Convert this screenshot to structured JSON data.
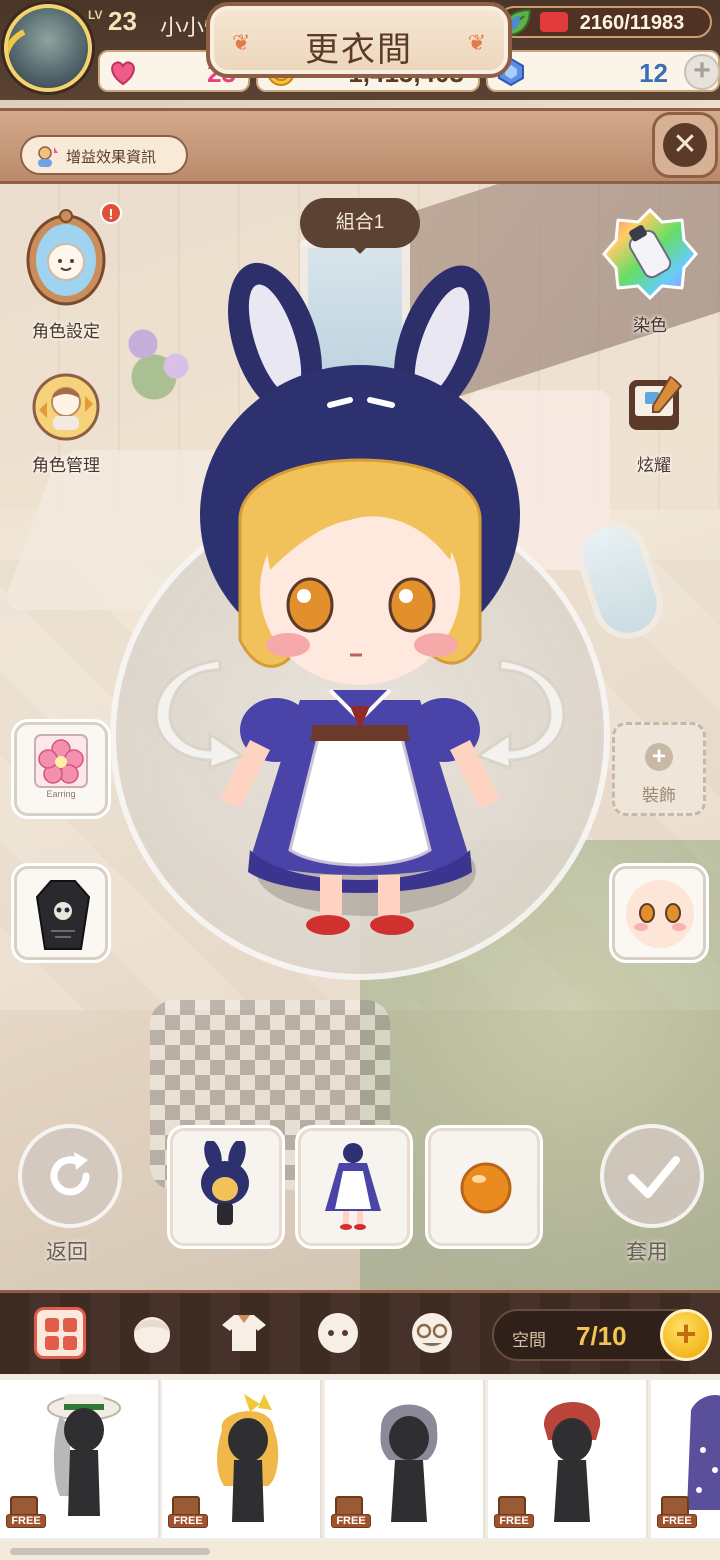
{
  "player": {
    "level_tag": "LV",
    "level": "23",
    "name": "小小慌"
  },
  "stamina": {
    "text": "2160/11983"
  },
  "resources": {
    "hearts": "23",
    "coins": "1,415,403",
    "gems": "12",
    "add_symbol": "+"
  },
  "header": {
    "buff_info_label": "增益效果資訊",
    "title": "更衣間",
    "close_symbol": "✕"
  },
  "side_left": {
    "character_settings": "角色設定",
    "character_manage": "角色管理",
    "badge": "!"
  },
  "side_right": {
    "dye": "染色",
    "show_off": "炫耀"
  },
  "combo": {
    "label": "組合1"
  },
  "slots": {
    "earring_label": "Earring",
    "decorate_label": "裝飾",
    "plus": "+"
  },
  "actions": {
    "back": "返回",
    "apply": "套用"
  },
  "storage": {
    "label": "空間",
    "value": "7/10",
    "add": "+"
  },
  "items": [
    {
      "tag": "FREE",
      "hair_color": "#b8b8b8"
    },
    {
      "tag": "FREE",
      "hair_color": "#f0b84a"
    },
    {
      "tag": "FREE",
      "hair_color": "#8a8a98"
    },
    {
      "tag": "FREE",
      "hair_color": "#b8443a"
    },
    {
      "tag": "FREE",
      "hair_color": "#5a4f9a"
    }
  ],
  "colors": {
    "accent_red": "#e25c4a",
    "gold": "#f4c453",
    "brown": "#5b3a2a"
  }
}
